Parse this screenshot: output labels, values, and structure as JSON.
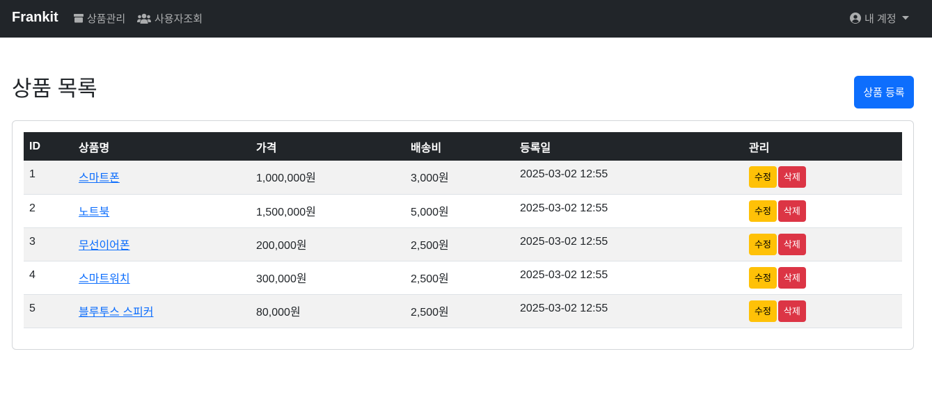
{
  "navbar": {
    "brand": "Frankit",
    "links": [
      {
        "label": "상품관리",
        "icon": "box-icon"
      },
      {
        "label": "사용자조회",
        "icon": "users-icon"
      }
    ],
    "account": {
      "label": "내 계정",
      "icon": "user-circle-icon"
    }
  },
  "page": {
    "title": "상품 목록",
    "register_button": "상품 등록"
  },
  "table": {
    "headers": [
      "ID",
      "상품명",
      "가격",
      "배송비",
      "등록일",
      "관리"
    ],
    "rows": [
      {
        "id": "1",
        "name": "스마트폰",
        "price": "1,000,000원",
        "shipping": "3,000원",
        "date": "2025-03-02 12:55"
      },
      {
        "id": "2",
        "name": "노트북",
        "price": "1,500,000원",
        "shipping": "5,000원",
        "date": "2025-03-02 12:55"
      },
      {
        "id": "3",
        "name": "무선이어폰",
        "price": "200,000원",
        "shipping": "2,500원",
        "date": "2025-03-02 12:55"
      },
      {
        "id": "4",
        "name": "스마트워치",
        "price": "300,000원",
        "shipping": "2,500원",
        "date": "2025-03-02 12:55"
      },
      {
        "id": "5",
        "name": "블루투스 스피커",
        "price": "80,000원",
        "shipping": "2,500원",
        "date": "2025-03-02 12:55"
      }
    ],
    "edit_label": "수정",
    "delete_label": "삭제"
  },
  "colors": {
    "navbar_bg": "#212529",
    "primary": "#0d6efd",
    "warning": "#ffc107",
    "danger": "#dc3545",
    "stripe": "#f2f2f2"
  }
}
